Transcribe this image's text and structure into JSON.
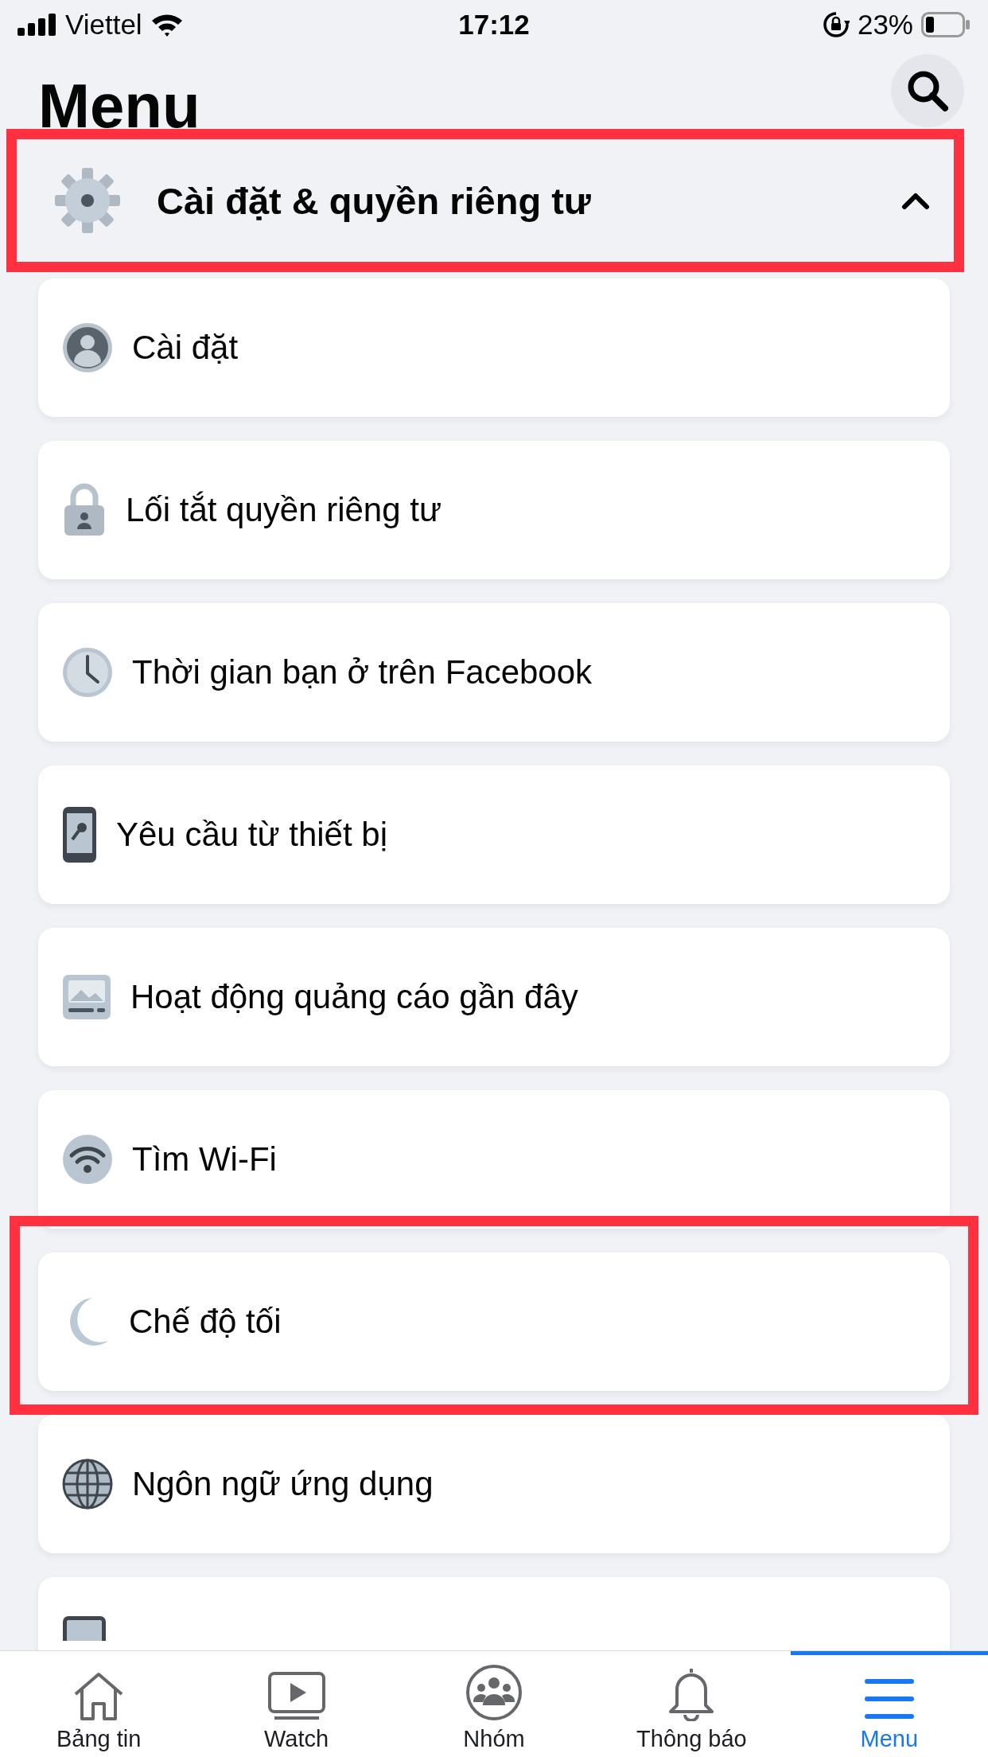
{
  "status_bar": {
    "carrier": "Viettel",
    "time": "17:12",
    "battery": "23%"
  },
  "title": "Menu",
  "section": {
    "label": "Cài đặt & quyền riêng tư",
    "expanded": true,
    "highlighted": true
  },
  "items": [
    {
      "kind": "person",
      "label": "Cài đặt",
      "highlighted": false
    },
    {
      "kind": "lock",
      "label": "Lối tắt quyền riêng tư",
      "highlighted": false
    },
    {
      "kind": "clock",
      "label": "Thời gian bạn ở trên Facebook",
      "highlighted": false
    },
    {
      "kind": "phone",
      "label": "Yêu cầu từ thiết bị",
      "highlighted": false
    },
    {
      "kind": "ad",
      "label": "Hoạt động quảng cáo gần đây",
      "highlighted": false
    },
    {
      "kind": "wifi",
      "label": "Tìm Wi-Fi",
      "highlighted": false
    },
    {
      "kind": "moon",
      "label": "Chế độ tối",
      "highlighted": true
    },
    {
      "kind": "globe",
      "label": "Ngôn ngữ ứng dụng",
      "highlighted": false
    },
    {
      "kind": "device",
      "highlighted": false
    }
  ],
  "tabs": [
    {
      "kind": "home",
      "label": "Bảng tin",
      "selected": false
    },
    {
      "kind": "watch",
      "label": "Watch",
      "selected": false
    },
    {
      "kind": "groups",
      "label": "Nhóm",
      "selected": false
    },
    {
      "kind": "bell",
      "label": "Thông báo",
      "selected": false
    },
    {
      "kind": "menu",
      "label": "Menu",
      "selected": true
    }
  ]
}
